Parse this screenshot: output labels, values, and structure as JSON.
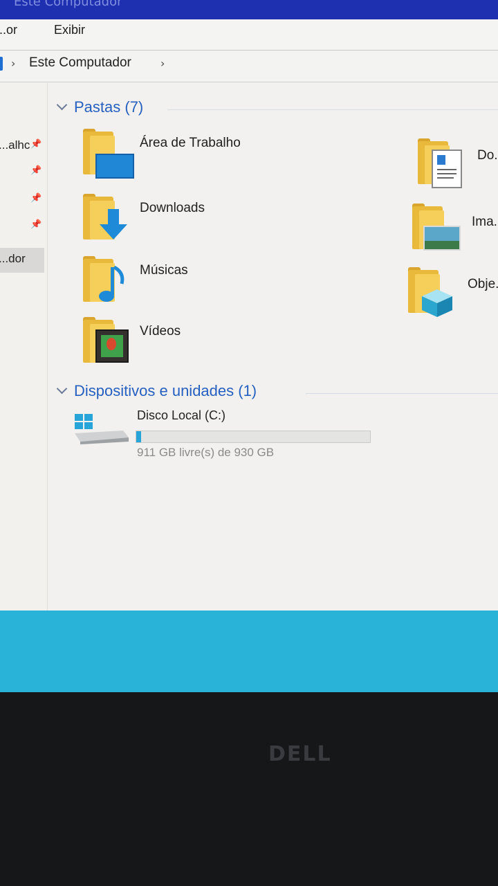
{
  "window": {
    "title": "Este Computador"
  },
  "ribbon": {
    "tabs": [
      "...or",
      "Exibir"
    ]
  },
  "address": {
    "path": "Este Computador"
  },
  "sidebar": {
    "items": [
      {
        "label": "...alhc",
        "pinned": true
      },
      {
        "label": "",
        "pinned": true
      },
      {
        "label": "",
        "pinned": true
      },
      {
        "label": "",
        "pinned": true
      },
      {
        "label": "...dor",
        "selected": true
      }
    ]
  },
  "folders": {
    "header": "Pastas (7)",
    "items": [
      {
        "label": "Área de Trabalho",
        "icon": "desktop-folder-icon"
      },
      {
        "label": "Downloads",
        "icon": "downloads-folder-icon"
      },
      {
        "label": "Músicas",
        "icon": "music-folder-icon"
      },
      {
        "label": "Vídeos",
        "icon": "videos-folder-icon"
      },
      {
        "label": "Do...",
        "icon": "documents-folder-icon"
      },
      {
        "label": "Ima...",
        "icon": "pictures-folder-icon"
      },
      {
        "label": "Obje...",
        "icon": "3d-objects-folder-icon"
      }
    ]
  },
  "devices": {
    "header": "Dispositivos e unidades (1)",
    "drive": {
      "label": "Disco Local (C:)",
      "free_text": "911 GB livre(s) de 930 GB",
      "used_fraction": 0.02,
      "icon": "local-disk-icon"
    }
  },
  "monitor": {
    "brand": "DELL"
  },
  "colors": {
    "accent": "#2560c0",
    "taskbar": "#29b3d8",
    "folder": "#f6cf5b",
    "usage": "#27a4d8"
  }
}
